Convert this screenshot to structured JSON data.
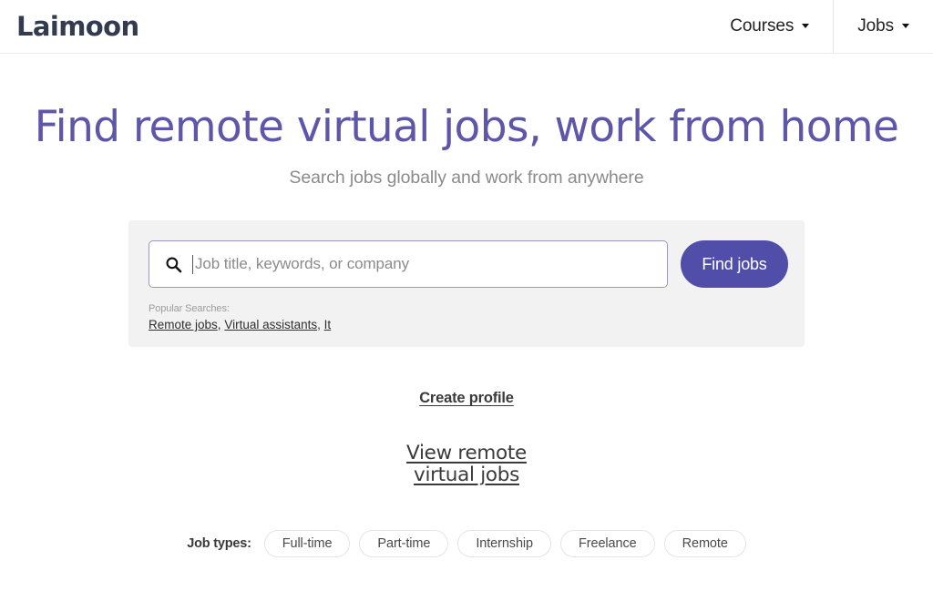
{
  "header": {
    "logo": "Laimoon",
    "nav": [
      {
        "label": "Courses",
        "icon": "chevron-down-icon",
        "divided": false
      },
      {
        "label": "Jobs",
        "icon": "chevron-down-icon",
        "divided": true
      }
    ]
  },
  "hero": {
    "headline": "Find remote virtual jobs, work from home",
    "subtitle": "Search jobs globally and work from anywhere",
    "headline_color": "#5d56a9",
    "subtitle_color": "#8a8a8a"
  },
  "search": {
    "icon": "search-icon",
    "value": "",
    "placeholder": "Job title, keywords, or company",
    "button_label": "Find jobs",
    "button_color": "#504ea8",
    "panel_color": "#f2f2f2",
    "popular_label": "Popular Searches:",
    "popular_links": [
      {
        "label": "Remote jobs",
        "separator": ","
      },
      {
        "label": "Virtual assistants",
        "separator": ","
      },
      {
        "label": "It",
        "separator": ""
      }
    ]
  },
  "links": {
    "create_profile": "Create profile",
    "view_jobs": "View remote virtual jobs"
  },
  "job_types": {
    "label": "Job types:",
    "items": [
      {
        "label": "Full-time"
      },
      {
        "label": "Part-time"
      },
      {
        "label": "Internship"
      },
      {
        "label": "Freelance"
      },
      {
        "label": "Remote"
      }
    ]
  }
}
